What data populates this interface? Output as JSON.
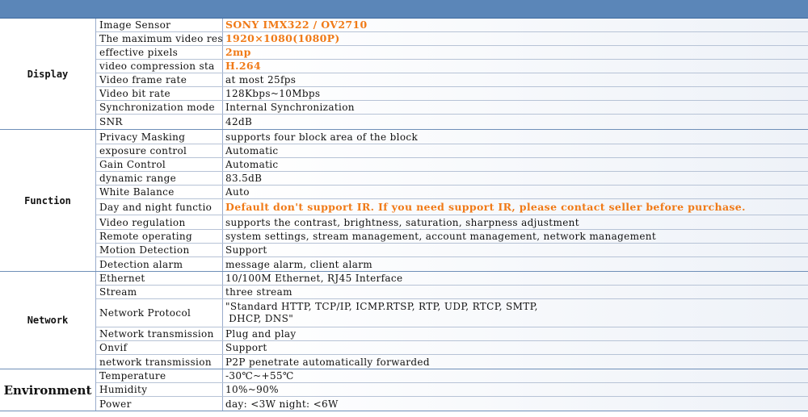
{
  "sections": [
    {
      "label": "Display",
      "rows": [
        {
          "key": "Image Sensor",
          "value": "SONY IMX322 / OV2710",
          "highlight": true
        },
        {
          "key": "The maximum video res",
          "value": "1920×1080(1080P)",
          "highlight": true
        },
        {
          "key": "effective pixels",
          "value": "2mp",
          "highlight": true
        },
        {
          "key": "video compression sta",
          "value": "H.264",
          "highlight": true
        },
        {
          "key": "Video frame rate",
          "value": "at most 25fps"
        },
        {
          "key": "Video bit rate",
          "value": "128Kbps~10Mbps"
        },
        {
          "key": "Synchronization mode",
          "value": "Internal Synchronization"
        },
        {
          "key": "SNR",
          "value": "42dB"
        }
      ]
    },
    {
      "label": "Function",
      "rows": [
        {
          "key": "Privacy Masking",
          "value": "supports four block area of the block"
        },
        {
          "key": "exposure control",
          "value": "Automatic"
        },
        {
          "key": "Gain Control",
          "value": "Automatic"
        },
        {
          "key": "dynamic range",
          "value": "83.5dB"
        },
        {
          "key": "White Balance",
          "value": "Auto"
        },
        {
          "key": "Day and night functio",
          "value": "Default don't support IR. If you need support IR, please contact seller before purchase.",
          "highlight": true
        },
        {
          "key": "Video regulation",
          "value": "supports the contrast, brightness, saturation, sharpness adjustment"
        },
        {
          "key": "Remote operating",
          "value": "system settings, stream management, account management, network management"
        },
        {
          "key": "Motion Detection",
          "value": "Support"
        },
        {
          "key": "Detection alarm",
          "value": "message alarm, client alarm"
        }
      ]
    },
    {
      "label": "Network",
      "rows": [
        {
          "key": "Ethernet",
          "value": " 10/100M Ethernet, RJ45 Interface"
        },
        {
          "key": "Stream",
          "value": "three stream"
        },
        {
          "key": "Network Protocol",
          "value": "\"Standard HTTP, TCP/IP, ICMP.RTSP, RTP, UDP, RTCP, SMTP,\n DHCP, DNS\"",
          "multiline": true
        },
        {
          "key": "Network transmission",
          "value": "Plug and play"
        },
        {
          "key": "Onvif",
          "value": "Support"
        },
        {
          "key": "network transmission",
          "value": "P2P penetrate automatically forwarded"
        }
      ]
    },
    {
      "label": "Environment",
      "big": true,
      "rows": [
        {
          "key": "Temperature",
          "value": "-30℃~+55℃"
        },
        {
          "key": "Humidity",
          "value": "10%~90%"
        },
        {
          "key": "Power",
          "value": "day: <3W     night: <6W"
        }
      ]
    }
  ]
}
